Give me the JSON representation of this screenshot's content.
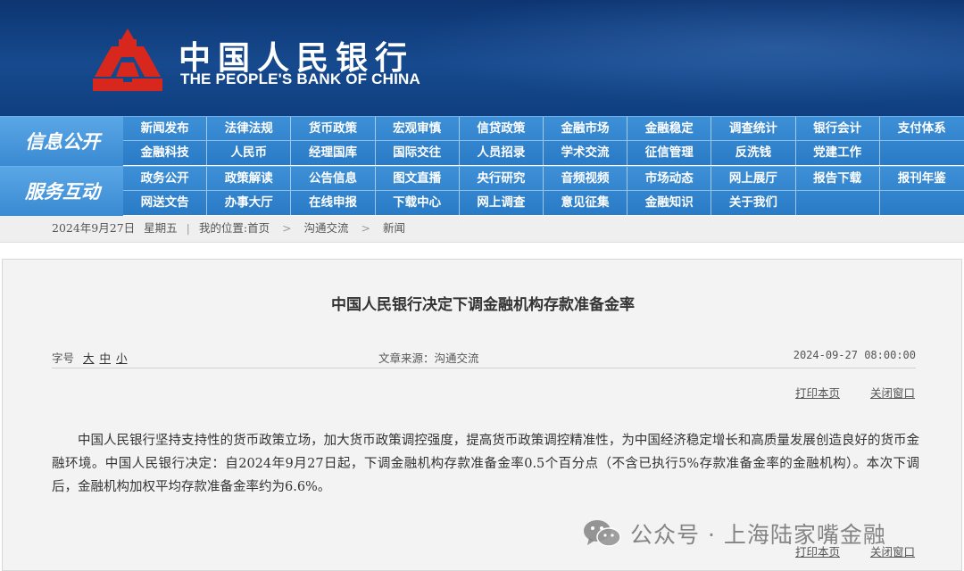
{
  "header": {
    "logo_cn": "中国人民银行",
    "logo_en": "THE PEOPLE'S BANK OF CHINA"
  },
  "nav": {
    "band1_title": "信息公开",
    "band1_items": [
      "新闻发布",
      "法律法规",
      "货币政策",
      "宏观审慎",
      "信贷政策",
      "金融市场",
      "金融稳定",
      "调查统计",
      "银行会计",
      "支付体系",
      "金融科技",
      "人民币",
      "经理国库",
      "国际交往",
      "人员招录",
      "学术交流",
      "征信管理",
      "反洗钱",
      "党建工作",
      ""
    ],
    "band2_title": "服务互动",
    "band2_items": [
      "政务公开",
      "政策解读",
      "公告信息",
      "图文直播",
      "央行研究",
      "音频视频",
      "市场动态",
      "网上展厅",
      "报告下载",
      "报刊年鉴",
      "网送文告",
      "办事大厅",
      "在线申报",
      "下载中心",
      "网上调查",
      "意见征集",
      "金融知识",
      "关于我们",
      "",
      ""
    ]
  },
  "breadcrumb": {
    "date": "2024年9月27日",
    "weekday": "星期五",
    "location_label": "我的位置:",
    "home": "首页",
    "level1": "沟通交流",
    "level2": "新闻",
    "separator": ">",
    "divider": "|"
  },
  "article": {
    "title": "中国人民银行决定下调金融机构存款准备金率",
    "font_label": "字号",
    "font_large": "大",
    "font_medium": "中",
    "font_small": "小",
    "source": "文章来源：沟通交流",
    "datetime": "2024-09-27 08:00:00",
    "print_label": "打印本页",
    "close_label": "关闭窗口",
    "body": "中国人民银行坚持支持性的货币政策立场，加大货币政策调控强度，提高货币政策调控精准性，为中国经济稳定增长和高质量发展创造良好的货币金融环境。中国人民银行决定：自2024年9月27日起，下调金融机构存款准备金率0.5个百分点（不含已执行5%存款准备金率的金融机构）。本次下调后，金融机构加权平均存款准备金率约为6.6%。"
  },
  "watermark": {
    "text": "公众号 · 上海陆家嘴金融",
    "icon": "wechat-icon"
  },
  "colors": {
    "banner": "#164a8e",
    "nav": "#2a7bc6",
    "logo_red": "#d8281e",
    "panel": "#f3f3f3"
  }
}
